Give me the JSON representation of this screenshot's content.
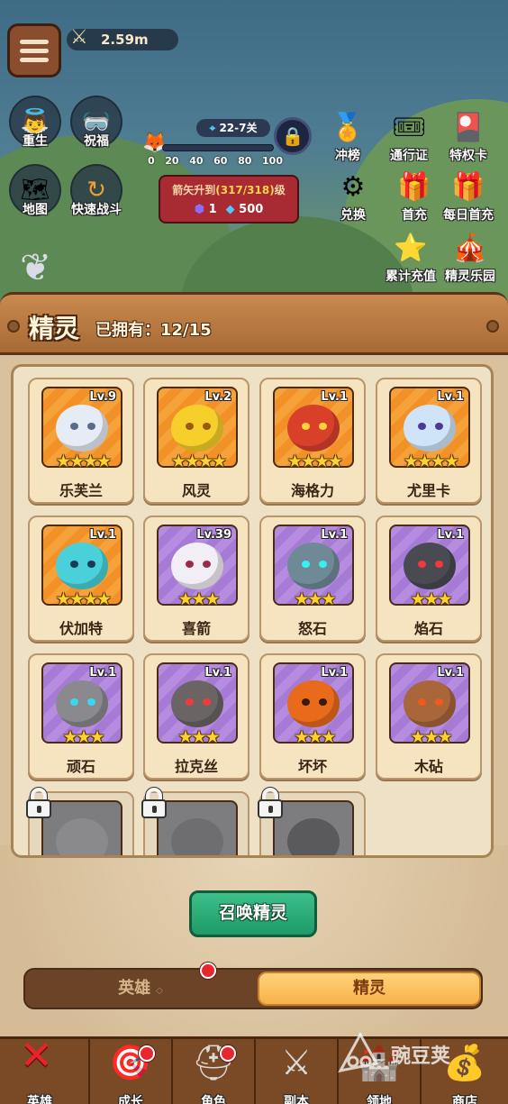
{
  "top": {
    "power": "2.59m",
    "left_buttons": [
      {
        "label": "重生",
        "icon": "angel-icon"
      },
      {
        "label": "祝福",
        "icon": "goggles-icon"
      },
      {
        "label": "地图",
        "icon": "map-icon"
      },
      {
        "label": "快速战斗",
        "icon": "fast-battle-icon"
      }
    ],
    "stage": {
      "label": "22-7关",
      "ticks": [
        "0",
        "20",
        "40",
        "60",
        "80",
        "100"
      ]
    },
    "arrow_upgrade": {
      "text_before": "箭矢升到",
      "progress": "(317/318)",
      "text_after": "级",
      "purple_gem": "1",
      "blue_gem": "500"
    },
    "right_buttons": [
      {
        "label": "冲榜",
        "icon": "ranking-medal-icon"
      },
      {
        "label": "通行证",
        "icon": "pass-icon"
      },
      {
        "label": "特权卡",
        "icon": "privilege-card-icon"
      },
      {
        "label": "兑换",
        "icon": "exchange-icon"
      },
      {
        "label": "首充",
        "icon": "gift-icon"
      },
      {
        "label": "每日首充",
        "icon": "daily-gift-icon"
      },
      {
        "label": "累计充值",
        "icon": "cumulative-recharge-icon"
      },
      {
        "label": "精灵乐园",
        "icon": "spirit-park-icon"
      }
    ]
  },
  "panel": {
    "title": "精灵",
    "owned": "已拥有：12/15"
  },
  "spirits": [
    {
      "name": "乐芙兰",
      "level": "Lv.9",
      "stars": "★★★★",
      "bg": "orange",
      "color": "#e6ecf6",
      "eye": "#5a6a8a"
    },
    {
      "name": "风灵",
      "level": "Lv.2",
      "stars": "★★★★",
      "bg": "orange",
      "color": "#f6cf2a",
      "eye": "#9a5a10"
    },
    {
      "name": "海格力",
      "level": "Lv.1",
      "stars": "★★★★",
      "bg": "orange",
      "color": "#d9402a",
      "eye": "#ffd23a"
    },
    {
      "name": "尤里卡",
      "level": "Lv.1",
      "stars": "★★★★",
      "bg": "orange",
      "color": "#cfe4f8",
      "eye": "#4a3a9a"
    },
    {
      "name": "伏加特",
      "level": "Lv.1",
      "stars": "★★★★",
      "bg": "orange",
      "color": "#4ad0d8",
      "eye": "#1a3a5a"
    },
    {
      "name": "喜箭",
      "level": "Lv.39",
      "stars": "★★★",
      "bg": "purple",
      "color": "#f2eef6",
      "eye": "#9a2a4a"
    },
    {
      "name": "怒石",
      "level": "Lv.1",
      "stars": "★★★",
      "bg": "purple",
      "color": "#6f8a96",
      "eye": "#38f0f0"
    },
    {
      "name": "焰石",
      "level": "Lv.1",
      "stars": "★★★",
      "bg": "purple",
      "color": "#4a4a52",
      "eye": "#f23a3a"
    },
    {
      "name": "顽石",
      "level": "Lv.1",
      "stars": "★★★",
      "bg": "purple",
      "color": "#8a8a8e",
      "eye": "#38d8f0"
    },
    {
      "name": "拉克丝",
      "level": "Lv.1",
      "stars": "★★★",
      "bg": "purple",
      "color": "#6a6464",
      "eye": "#f23a3a"
    },
    {
      "name": "坏坏",
      "level": "Lv.1",
      "stars": "★★★",
      "bg": "purple",
      "color": "#e86a1a",
      "eye": "#3a1a0a"
    },
    {
      "name": "木砧",
      "level": "Lv.1",
      "stars": "★★★",
      "bg": "purple",
      "color": "#a8663a",
      "eye": "#f25a1a"
    }
  ],
  "locked_count_shown": 3,
  "summon_button": "召唤精灵",
  "toggle": {
    "left": "英雄",
    "right": "精灵"
  },
  "nav": [
    {
      "label": "英雄",
      "icon": "close-x-icon"
    },
    {
      "label": "成长",
      "icon": "target-dummy-icon"
    },
    {
      "label": "角色",
      "icon": "knight-helmet-icon"
    },
    {
      "label": "副本",
      "icon": "crossed-swords-icon"
    },
    {
      "label": "领地",
      "icon": "territory-icon"
    },
    {
      "label": "商店",
      "icon": "treasure-chest-icon"
    }
  ],
  "watermark": "豌豆荚",
  "colors": {
    "summon_green": "#1e9a66",
    "active_tab": "#f7b24a",
    "badge_red": "#e8262e"
  }
}
